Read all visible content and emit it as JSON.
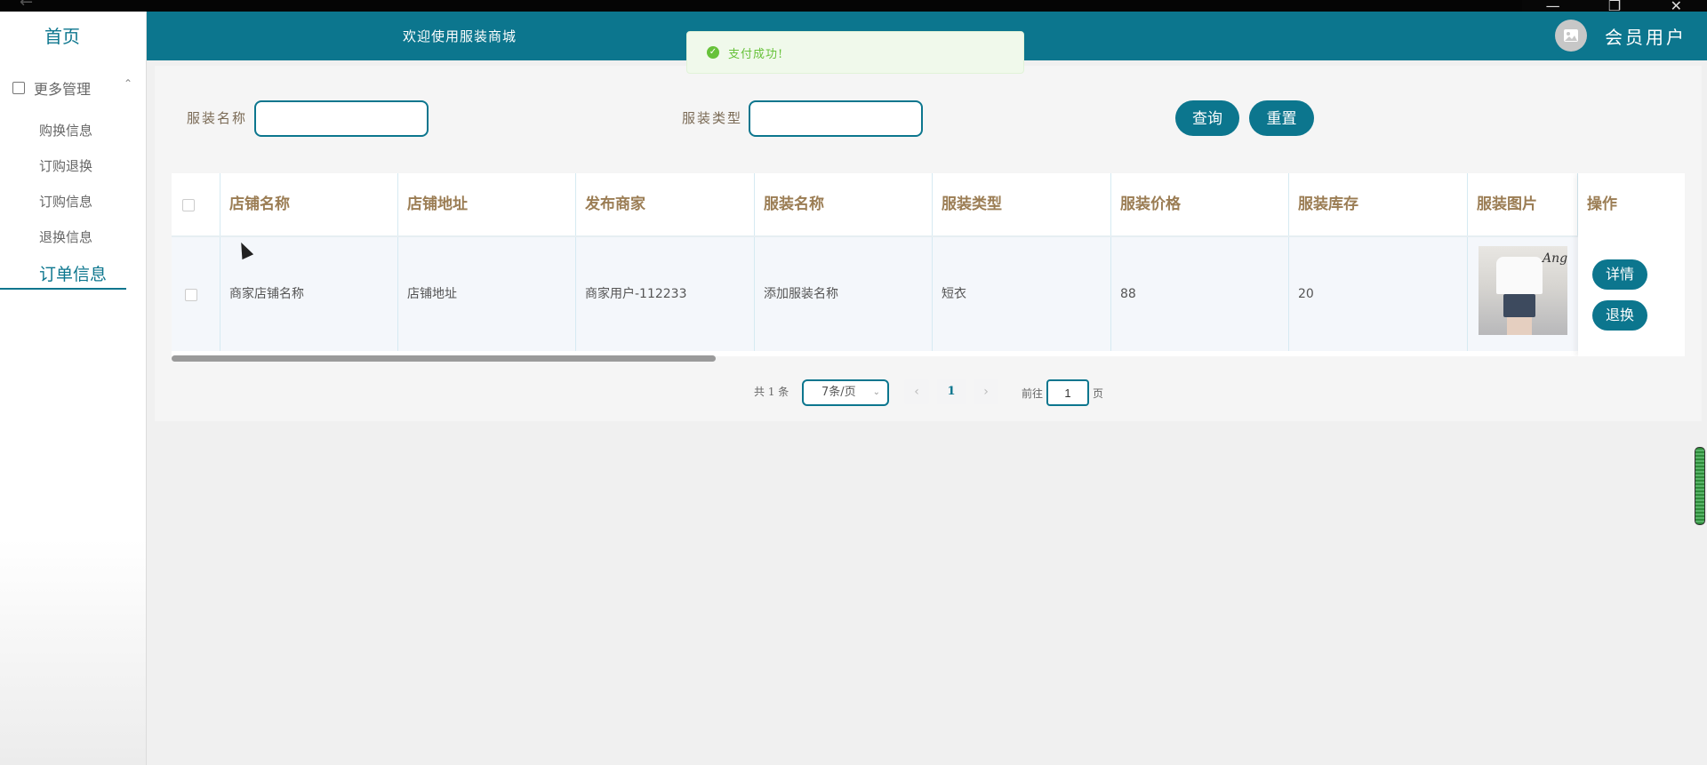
{
  "header": {
    "welcome": "欢迎使用服装商城",
    "user": "会员用户"
  },
  "toast": {
    "message": "支付成功!"
  },
  "sidebar": {
    "home": "首页",
    "group": "更多管理",
    "items": [
      "购换信息",
      "订购退换",
      "订购信息",
      "退换信息"
    ],
    "active": "订单信息"
  },
  "filters": {
    "name_label": "服装名称",
    "name_value": "",
    "type_label": "服装类型",
    "type_value": "",
    "search_label": "查询",
    "reset_label": "重置"
  },
  "table": {
    "columns": [
      "店铺名称",
      "店铺地址",
      "发布商家",
      "服装名称",
      "服装类型",
      "服装价格",
      "服装库存",
      "服装图片",
      "操作"
    ],
    "rows": [
      {
        "shop_name": "商家店铺名称",
        "shop_address": "店铺地址",
        "merchant": "商家用户-112233",
        "clothing_name": "添加服装名称",
        "clothing_type": "短衣",
        "price": "88",
        "stock": "20",
        "image_text": "Ange",
        "actions": [
          "详情",
          "退换"
        ]
      }
    ]
  },
  "pagination": {
    "total": "共 1 条",
    "page_size": "7条/页",
    "current_page": "1",
    "goto_prefix": "前往",
    "goto_value": "1",
    "goto_suffix": "页"
  },
  "colors": {
    "primary": "#0c768e",
    "success": "#67c23a",
    "header_text": "#9b7d54"
  }
}
